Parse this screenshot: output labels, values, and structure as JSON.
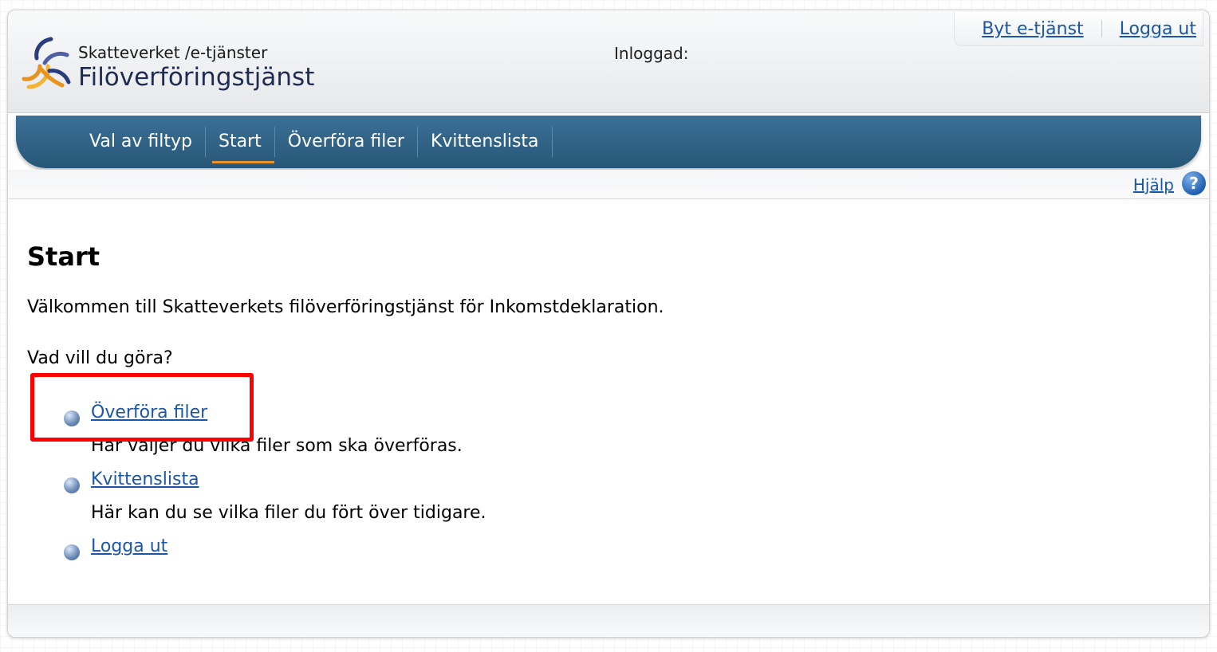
{
  "header": {
    "org_name": "Skatteverket /e-tjänster",
    "service_name": "Filöverföringstjänst",
    "logged_in_label": "Inloggad:",
    "top_links": [
      {
        "label": "Byt e-tjänst"
      },
      {
        "label": "Logga ut"
      }
    ]
  },
  "nav": {
    "items": [
      {
        "label": "Val av filtyp",
        "active": false
      },
      {
        "label": "Start",
        "active": true
      },
      {
        "label": "Överföra filer",
        "active": false
      },
      {
        "label": "Kvittenslista",
        "active": false
      }
    ]
  },
  "help": {
    "label": "Hjälp",
    "icon": "help-question-icon",
    "icon_glyph": "?"
  },
  "main": {
    "title": "Start",
    "welcome": "Välkommen till Skatteverkets filöverföringstjänst för Inkomstdeklaration.",
    "question": "Vad vill du göra?",
    "options": [
      {
        "label": "Överföra filer",
        "description": "Här väljer du vilka filer som ska överföras."
      },
      {
        "label": "Kvittenslista",
        "description": "Här kan du se vilka filer du fört över tidigare."
      },
      {
        "label": "Logga ut",
        "description": ""
      }
    ]
  },
  "colors": {
    "nav_background": "#306386",
    "link": "#1b56a7",
    "active_underline": "#e9932a",
    "annotation_box": "#ff0000"
  }
}
